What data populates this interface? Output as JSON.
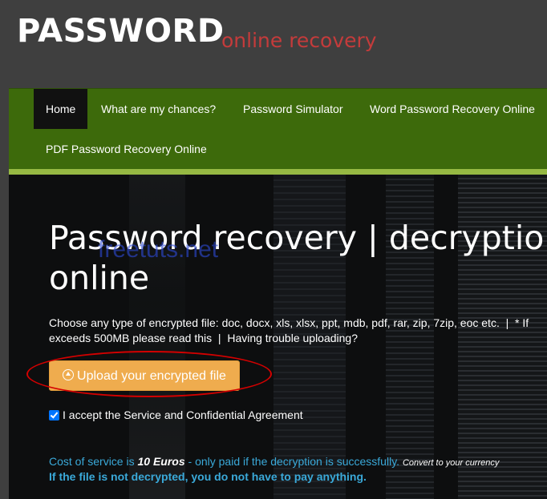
{
  "header": {
    "logo_main": "PASSWORD",
    "logo_sub": "online recovery"
  },
  "nav": {
    "items": [
      {
        "label": "Home",
        "active": true
      },
      {
        "label": "What are my chances?"
      },
      {
        "label": "Password Simulator"
      },
      {
        "label": "Word Password Recovery Online"
      },
      {
        "label": "PDF Password Recovery Online"
      }
    ]
  },
  "watermark": "freetuts.net",
  "hero": {
    "title_line1": "Password recovery | decryption",
    "title_line2": "online",
    "file_types": "Choose any type of encrypted file: doc, docx, xls, xlsx, ppt, mdb, pdf, rar, zip, 7zip, eoc etc.",
    "separator1": "|",
    "note_start": "* If",
    "note_line2": "exceeds 500MB please read this",
    "separator2": "|",
    "trouble_link": "Having trouble uploading?",
    "upload_label": "Upload your encrypted file",
    "upload_icon": "upload-circle-icon",
    "accept_label": "I accept the Service and Confidential Agreement",
    "accept_checked": true,
    "cost_prefix": "Cost of service is",
    "cost_amount": "10 Euros",
    "cost_suffix": "- only paid if the decryption is successfully.",
    "convert_link": "Convert to your currency",
    "guarantee": "If the file is not decrypted, you do not have to pay anything."
  },
  "colors": {
    "nav_bg": "#3d6a0b",
    "nav_bar": "#96b943",
    "logo_sub": "#c43b3b",
    "upload_button": "#efac4e",
    "cost_text": "#3aa9d9",
    "annotation": "#d40000"
  }
}
